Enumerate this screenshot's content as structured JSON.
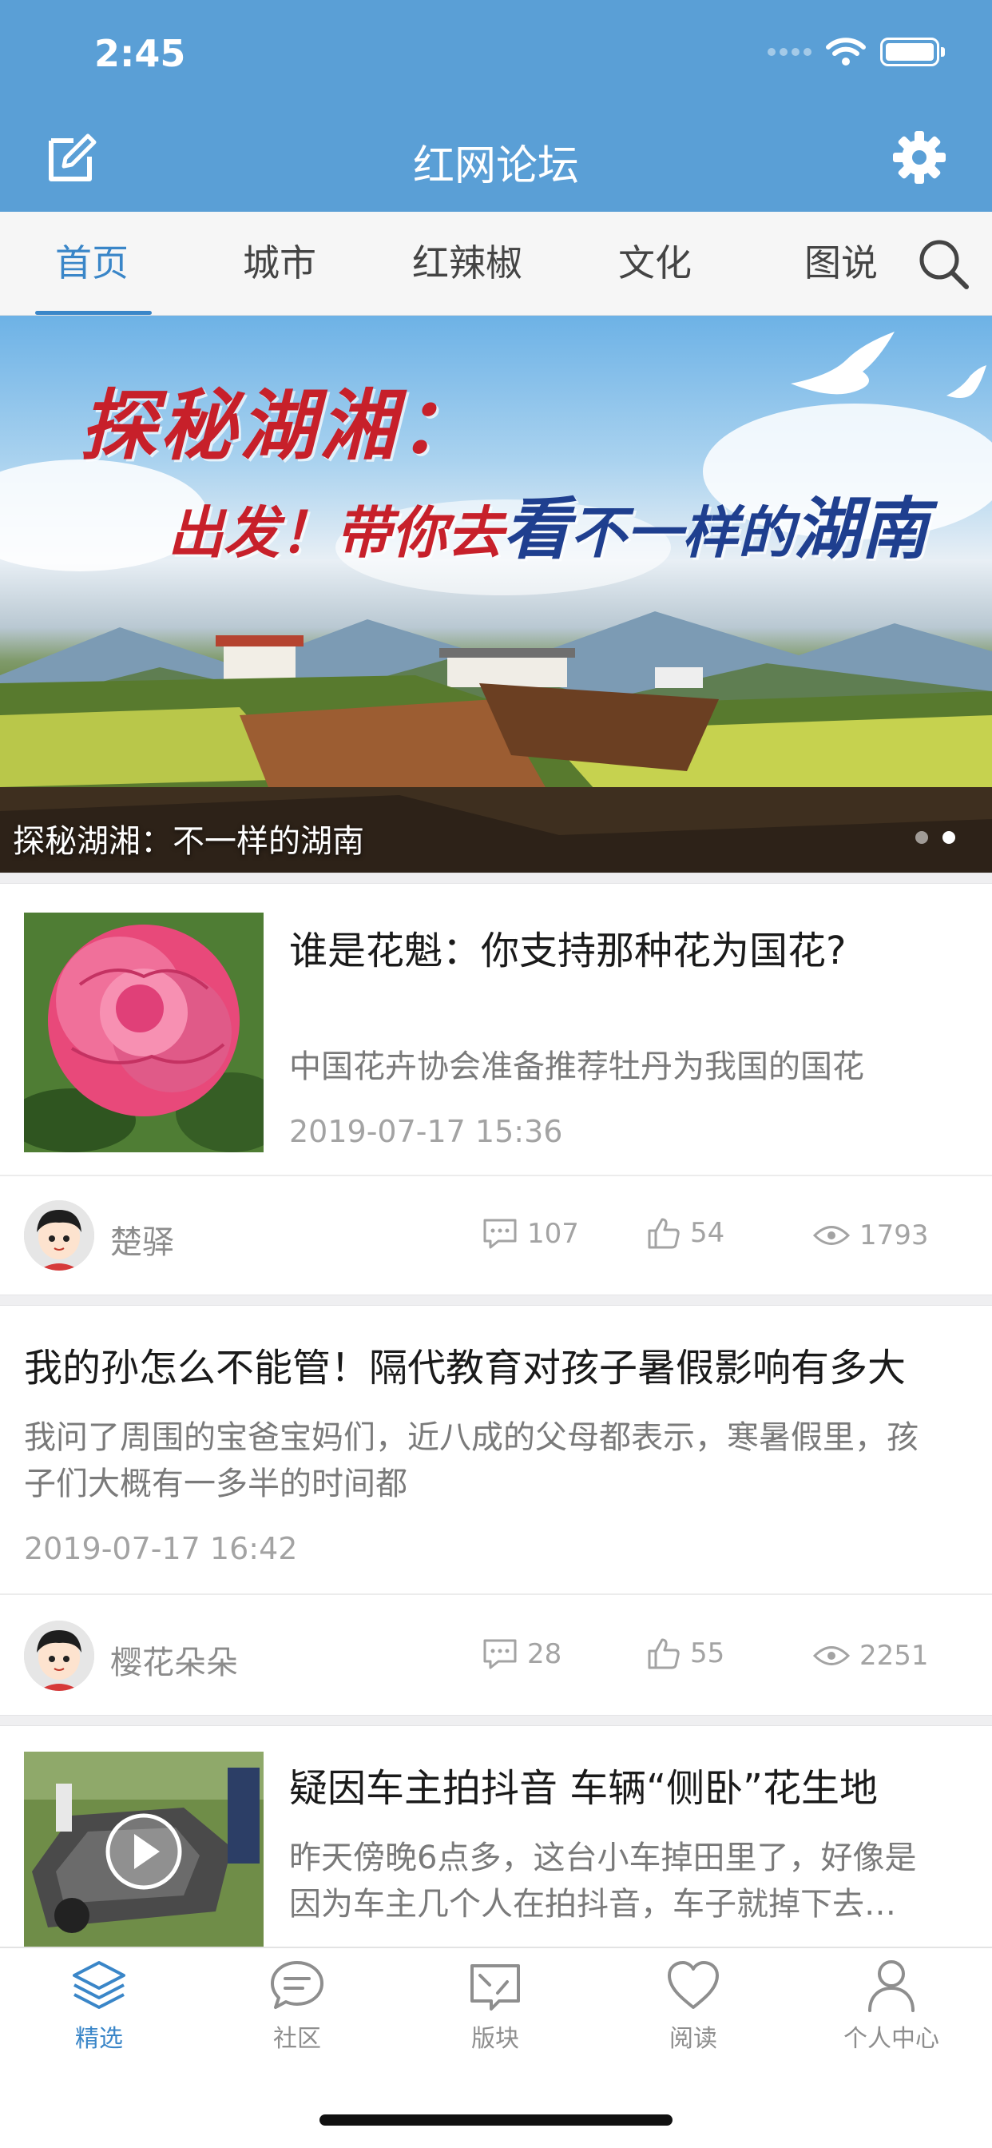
{
  "status_bar": {
    "time": "2:45"
  },
  "nav": {
    "title": "红网论坛",
    "edit_icon": "edit-icon",
    "settings_icon": "gear-icon"
  },
  "tabs": {
    "items": [
      {
        "label": "首页",
        "active": true
      },
      {
        "label": "城市",
        "active": false
      },
      {
        "label": "红辣椒",
        "active": false
      },
      {
        "label": "文化",
        "active": false
      },
      {
        "label": "图说",
        "active": false
      }
    ],
    "search_icon": "search-icon"
  },
  "banner": {
    "line1": "探秘湖湘：",
    "line2_a": "出发！带你去",
    "line2_b": "看",
    "line2_c": "不一样的",
    "line2_d": "湖南",
    "caption": "探秘湖湘：不一样的湖南",
    "page_count": 2,
    "active_page": 2
  },
  "posts": [
    {
      "title": "谁是花魁：你支持那种花为国花?",
      "summary": "中国花卉协会准备推荐牡丹为我国的国花",
      "date": "2019-07-17 15:36",
      "author": "楚驿",
      "comments": "107",
      "likes": "54",
      "views": "1793"
    },
    {
      "title": "我的孙怎么不能管！隔代教育对孩子暑假影响有多大",
      "summary_line1": "我问了周围的宝爸宝妈们，近八成的父母都表示，寒暑假里，孩",
      "summary_line2": "子们大概有一多半的时间都",
      "date": "2019-07-17 16:42",
      "author": "樱花朵朵",
      "comments": "28",
      "likes": "55",
      "views": "2251"
    },
    {
      "title": "疑因车主拍抖音 车辆“侧卧”花生地",
      "summary_line1": "昨天傍晚6点多，这台小车掉田里了，好像是",
      "summary_line2": "因为车主几个人在拍抖音，车子就掉下去…"
    }
  ],
  "tabbar": {
    "items": [
      {
        "label": "精选",
        "icon": "layers-icon",
        "active": true
      },
      {
        "label": "社区",
        "icon": "chat-bubble-icon",
        "active": false
      },
      {
        "label": "版块",
        "icon": "board-icon",
        "active": false
      },
      {
        "label": "阅读",
        "icon": "heart-icon",
        "active": false
      },
      {
        "label": "个人中心",
        "icon": "person-icon",
        "active": false
      }
    ]
  },
  "colors": {
    "primary": "#5a9fd6",
    "accent": "#3a86c8",
    "muted": "#a3a3a3"
  }
}
